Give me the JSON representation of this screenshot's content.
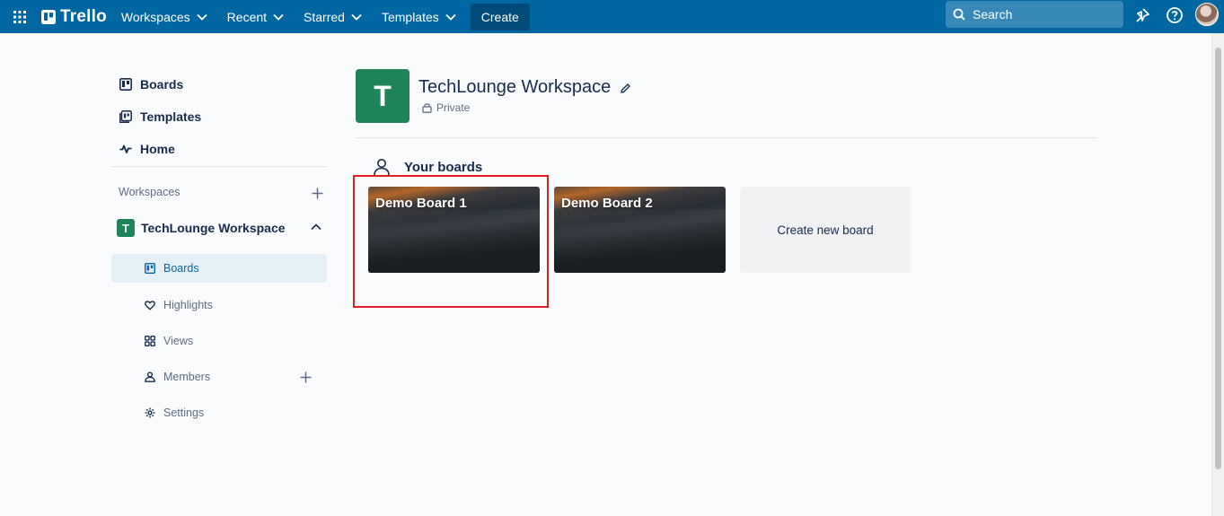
{
  "topbar": {
    "logo_text": "Trello",
    "nav": [
      {
        "label": "Workspaces"
      },
      {
        "label": "Recent"
      },
      {
        "label": "Starred"
      },
      {
        "label": "Templates"
      }
    ],
    "create_label": "Create",
    "search_placeholder": "Search",
    "icons": [
      "apps-grid-icon",
      "trello-logo-icon",
      "search-icon",
      "notifications-icon",
      "help-icon",
      "avatar"
    ]
  },
  "sidebar": {
    "main_items": [
      {
        "label": "Boards",
        "icon": "board-icon"
      },
      {
        "label": "Templates",
        "icon": "template-icon"
      },
      {
        "label": "Home",
        "icon": "activity-icon"
      }
    ],
    "workspaces_heading": "Workspaces",
    "workspace": {
      "badge": "T",
      "name": "TechLounge Workspace"
    },
    "sub_items": [
      {
        "label": "Boards",
        "icon": "board-icon",
        "active": true
      },
      {
        "label": "Highlights",
        "icon": "heart-icon"
      },
      {
        "label": "Views",
        "icon": "grid-icon"
      },
      {
        "label": "Members",
        "icon": "members-icon"
      },
      {
        "label": "Settings",
        "icon": "gear-icon"
      }
    ]
  },
  "main": {
    "workspace_logo_letter": "T",
    "workspace_title": "TechLounge Workspace",
    "visibility": "Private",
    "section_title": "Your boards",
    "boards": [
      {
        "title": "Demo Board 1"
      },
      {
        "title": "Demo Board 2"
      }
    ],
    "create_board_label": "Create new board"
  },
  "colors": {
    "topbar": "#0067a3",
    "workspace_green": "#1f845a",
    "highlight_red": "#e02020",
    "active_bg": "#e4f0f6"
  }
}
